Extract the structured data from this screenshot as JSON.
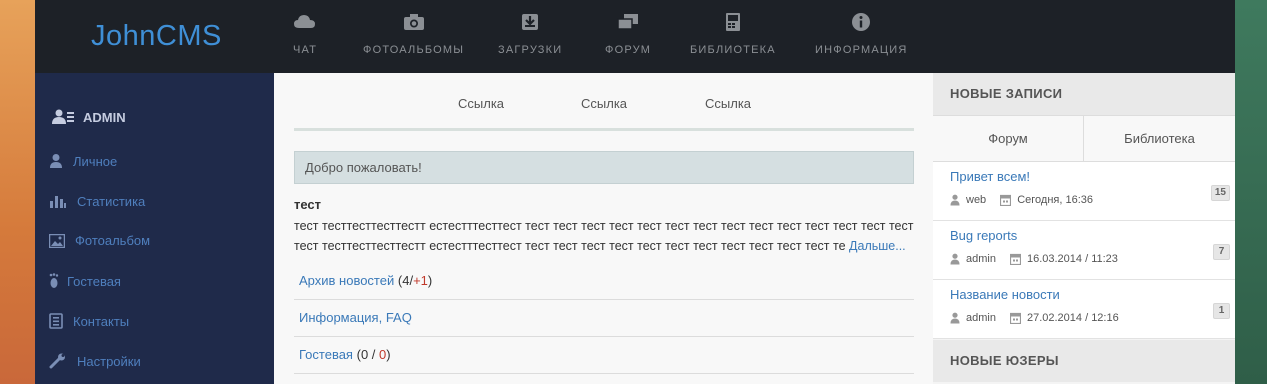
{
  "brand": {
    "logo": "JohnCMS"
  },
  "nav": [
    {
      "label": "ЧАТ",
      "icon": "cloud-icon"
    },
    {
      "label": "ФОТОАЛЬБОМЫ",
      "icon": "camera-icon"
    },
    {
      "label": "ЗАГРУЗКИ",
      "icon": "download-icon"
    },
    {
      "label": "ФОРУМ",
      "icon": "comments-icon"
    },
    {
      "label": "БИБЛИОТЕКА",
      "icon": "book-icon"
    },
    {
      "label": "ИНФОРМАЦИЯ",
      "icon": "info-icon"
    }
  ],
  "sidebar": {
    "user": "ADMIN",
    "items": [
      {
        "label": "Личное",
        "icon": "user-icon"
      },
      {
        "label": "Статистика",
        "icon": "bar-chart-icon"
      },
      {
        "label": "Фотоальбом",
        "icon": "picture-icon"
      },
      {
        "label": "Гостевая",
        "icon": "footprint-icon"
      },
      {
        "label": "Контакты",
        "icon": "contacts-icon"
      },
      {
        "label": "Настройки",
        "icon": "wrench-icon"
      }
    ]
  },
  "main": {
    "tabs": [
      "Ссылка",
      "Ссылка",
      "Ссылка"
    ],
    "welcome": "Добро пожаловать!",
    "news": {
      "title": "тест",
      "text": "тест тесттесттесттестт естестттесттест тест тест тест тест тест тест тест тест тест тест тест тест тест тест тест тесттесттесттестт естестттесттест тест тест тест тест тест тест тест тест тест тест тест те",
      "more": "Дальше..."
    },
    "archive": {
      "label": "Архив новостей",
      "open": "(",
      "count": "4",
      "slash": "/",
      "new": "+1",
      "close": ")"
    },
    "info": {
      "label": "Информация, FAQ"
    },
    "guest": {
      "label": "Гостевая",
      "open": "(",
      "count": "0",
      "slash": " / ",
      "new": "0",
      "close": ")"
    }
  },
  "right": {
    "new_posts_title": "НОВЫЕ ЗАПИСИ",
    "tabs": [
      "Форум",
      "Библиотека"
    ],
    "posts": [
      {
        "title": "Привет всем!",
        "author": "web",
        "date": "Сегодня, 16:36",
        "count": "15"
      },
      {
        "title": "Bug reports",
        "author": "admin",
        "date": "16.03.2014 / 11:23",
        "count": "7"
      },
      {
        "title": "Название новости",
        "author": "admin",
        "date": "27.02.2014 / 12:16",
        "count": "1"
      }
    ],
    "new_users_title": "НОВЫЕ ЮЗЕРЫ"
  },
  "colors": {
    "header_bg": "#1d2127",
    "sidebar_bg": "#1f2a4a",
    "accent_link": "#3a79b8",
    "logo": "#3f8fd6",
    "badge_red": "#c0392b"
  }
}
